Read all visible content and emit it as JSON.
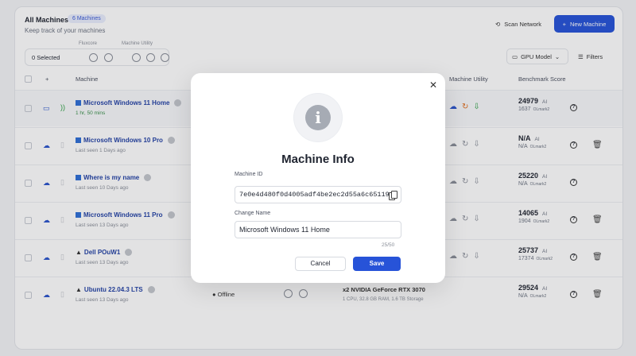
{
  "header": {
    "title": "All Machines",
    "count_badge": "6 Machines",
    "subtitle": "Keep track of your machines",
    "scan_label": "Scan Network",
    "new_label": "New Machine"
  },
  "toolbar": {
    "selected_label": "0 Selected",
    "fluxcore_label": "Fluxcore",
    "utility_label": "Machine Utility",
    "gpu_model_label": "GPU Model",
    "filters_label": "Filters"
  },
  "table": {
    "columns": [
      "Machine",
      "Machine Utility",
      "Benchmark Score"
    ],
    "rows": [
      {
        "name": "Microsoft Windows 11 Home",
        "sub": "1 hr, 50 mins",
        "score": "24979",
        "score_tag": "AI",
        "sub_score": "1637",
        "sub_tag": "OLmark2"
      },
      {
        "name": "Microsoft Windows 10 Pro",
        "sub": "Last seen 1 Days ago",
        "score": "N/A",
        "score_tag": "AI",
        "sub_score": "N/A",
        "sub_tag": "OLmark2"
      },
      {
        "name": "Where is my name",
        "sub": "Last seen 10 Days ago",
        "score": "25220",
        "score_tag": "AI",
        "sub_score": "N/A",
        "sub_tag": "OLmark2"
      },
      {
        "name": "Microsoft Windows 11 Pro",
        "sub": "Last seen 13 Days ago",
        "score": "14065",
        "score_tag": "AI",
        "sub_score": "1904",
        "sub_tag": "OLmark2"
      },
      {
        "name": "Dell POuW1",
        "sub": "Last seen 13 Days ago",
        "score": "25737",
        "score_tag": "AI",
        "sub_score": "17374",
        "sub_tag": "OLmark2"
      },
      {
        "name": "Ubuntu 22.04.3 LTS",
        "sub": "Last seen 13 Days ago",
        "status": "Offline",
        "gpu": "x2 NVIDIA GeForce RTX 3070",
        "gpu_specs": "1 CPU, 32.8 GB RAM, 1.6 TB Storage",
        "score": "29524",
        "score_tag": "AI",
        "sub_score": "N/A",
        "sub_tag": "OLmark2"
      }
    ]
  },
  "modal": {
    "title": "Machine Info",
    "machine_id_label": "Machine ID",
    "machine_id_value": "7e0e4d480f0d4005adf4be2ec2d55a6c65119",
    "change_name_label": "Change Name",
    "change_name_value": "Microsoft Windows 11 Home",
    "char_count": "25/50",
    "cancel_label": "Cancel",
    "save_label": "Save",
    "info_glyph": "i"
  },
  "colors": {
    "accent": "#2753d8",
    "link": "#2443a6",
    "online": "#2ea043"
  },
  "icons": [
    "laptop-icon",
    "cloud-icon",
    "signal-icon",
    "refresh-icon",
    "download-icon",
    "help-icon",
    "trash-icon",
    "close-icon",
    "copy-icon",
    "info-icon",
    "filter-icon",
    "scan-icon"
  ]
}
